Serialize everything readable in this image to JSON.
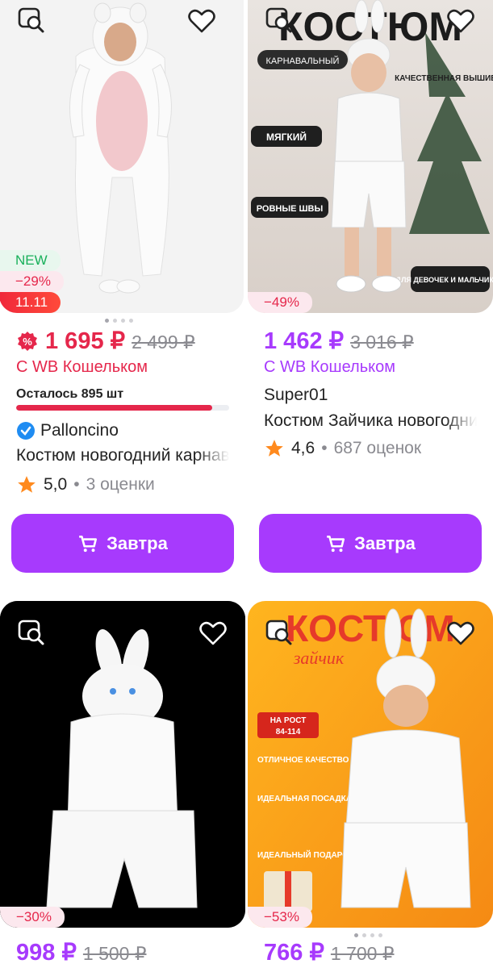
{
  "products": [
    {
      "badges": {
        "new": "NEW",
        "discount": "−29%",
        "promo": "11.11"
      },
      "price": "1 695 ₽",
      "old_price": "2 499 ₽",
      "wallet": "С WB Кошельком",
      "remaining": "Осталось 895 шт",
      "remaining_fraction": 0.92,
      "seller": "Palloncino",
      "title": "Костюм новогодний карнавальный",
      "rating": "5,0",
      "reviews": "3 оценки",
      "button": "Завтра"
    },
    {
      "discount": "−49%",
      "overlay": {
        "headline": "КОСТЮМ",
        "tag_carnival": "КАРНАВАЛЬНЫЙ",
        "tag_embroidery": "КАЧЕСТВЕННАЯ ВЫШИВКА",
        "tag_soft": "МЯГКИЙ",
        "tag_seams": "РОВНЫЕ ШВЫ",
        "tag_kids": "ДЛЯ ДЕВОЧЕК И МАЛЬЧИКОВ"
      },
      "price": "1 462 ₽",
      "old_price": "3 016 ₽",
      "wallet": "С WB Кошельком",
      "seller": "Super01",
      "title": "Костюм Зайчика новогодний",
      "rating": "4,6",
      "reviews": "687 оценок",
      "button": "Завтра"
    },
    {
      "discount": "−30%",
      "price": "998 ₽",
      "old_price": "1 500 ₽"
    },
    {
      "discount": "−53%",
      "overlay": {
        "headline": "КОСТЮМ",
        "script": "зайчик",
        "height_tag": "НА РОСТ 84-114",
        "quality": "ОТЛИЧНОЕ КАЧЕСТВО",
        "fit": "ИДЕАЛЬНАЯ ПОСАДКА",
        "gift": "ИДЕАЛЬНЫЙ ПОДАРОК"
      },
      "price": "766 ₽",
      "old_price": "1 700 ₽"
    }
  ],
  "colors": {
    "accent": "#a73afd",
    "sale": "#e5274b",
    "star": "#ff8a1e"
  }
}
